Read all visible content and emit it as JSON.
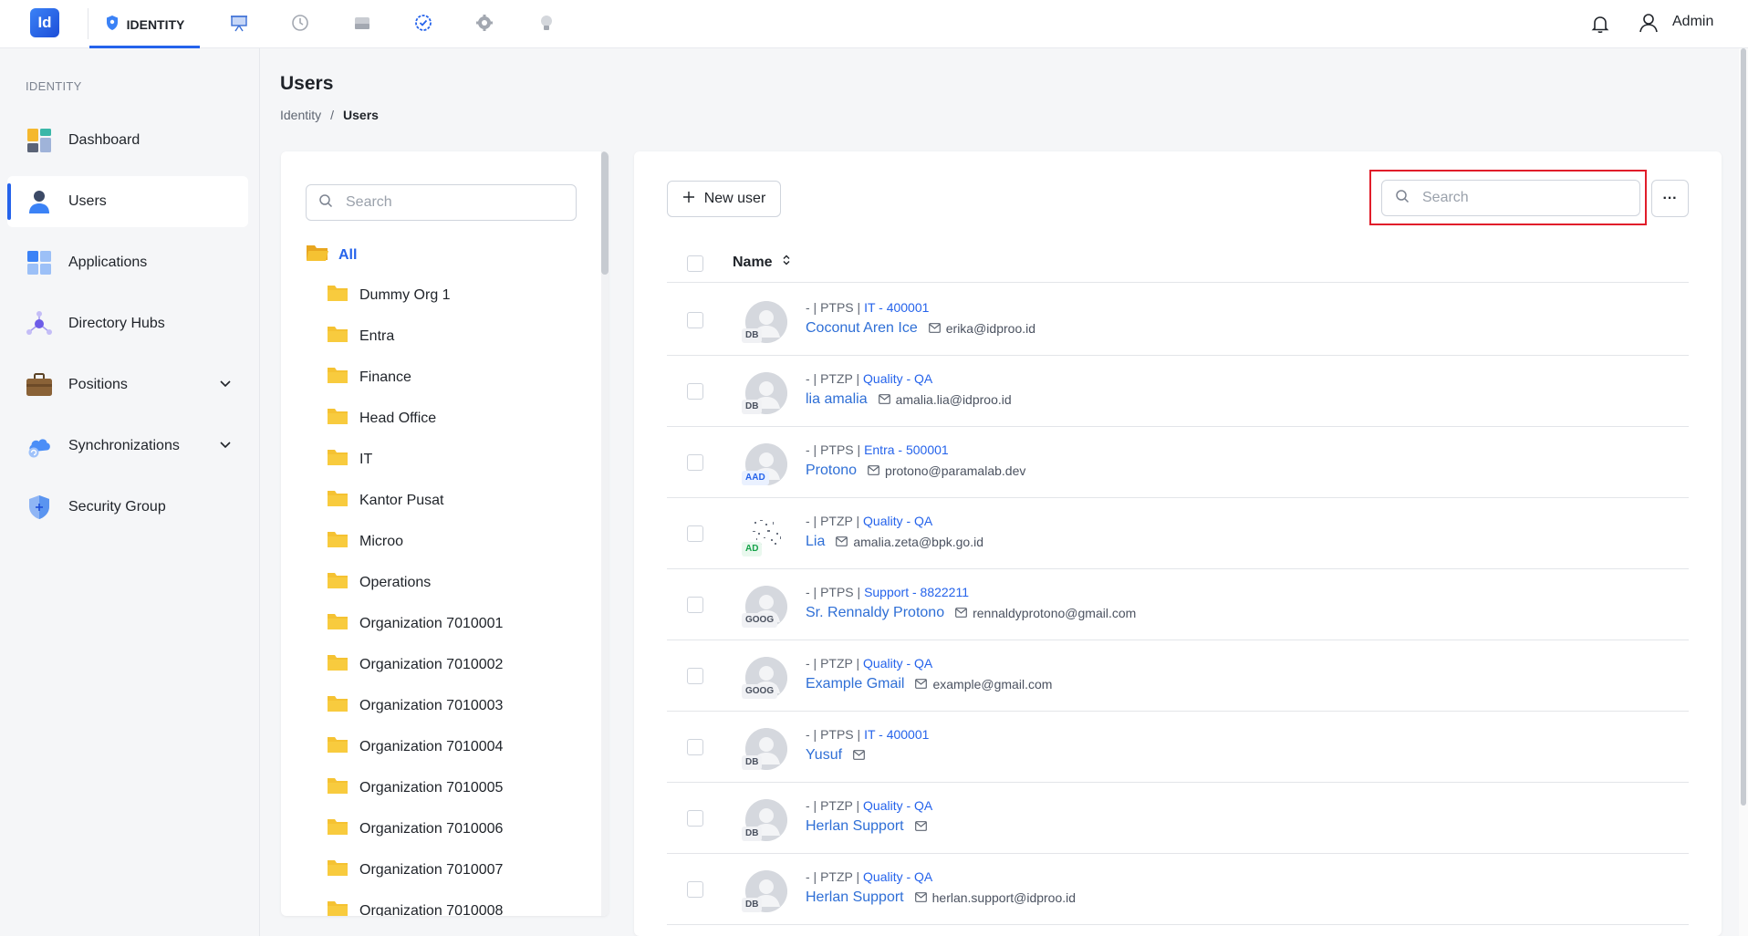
{
  "app": {
    "logo_text": "Id",
    "active_module": "IDENTITY",
    "user_label": "Admin"
  },
  "top_nav_icons": [
    "shield-icon",
    "presentation-icon",
    "history-icon",
    "drive-icon",
    "check-circle-icon",
    "gear-icon",
    "lightbulb-icon"
  ],
  "sidebar": {
    "section": "IDENTITY",
    "items": [
      {
        "label": "Dashboard",
        "icon": "dashboard-icon"
      },
      {
        "label": "Users",
        "icon": "user-icon",
        "active": true
      },
      {
        "label": "Applications",
        "icon": "applications-icon"
      },
      {
        "label": "Directory Hubs",
        "icon": "hub-icon"
      },
      {
        "label": "Positions",
        "icon": "briefcase-icon",
        "expandable": true
      },
      {
        "label": "Synchronizations",
        "icon": "cloud-sync-icon",
        "expandable": true
      },
      {
        "label": "Security Group",
        "icon": "shield-plus-icon"
      }
    ]
  },
  "page": {
    "title": "Users",
    "breadcrumb": [
      "Identity",
      "/",
      "Users"
    ]
  },
  "org_panel": {
    "search_placeholder": "Search",
    "all_label": "All",
    "items": [
      "Dummy Org 1",
      "Entra",
      "Finance",
      "Head Office",
      "IT",
      "Kantor Pusat",
      "Microo",
      "Operations",
      "Organization 7010001",
      "Organization 7010002",
      "Organization 7010003",
      "Organization 7010004",
      "Organization 7010005",
      "Organization 7010006",
      "Organization 7010007",
      "Organization 7010008"
    ]
  },
  "users_panel": {
    "new_user_label": "New user",
    "search_placeholder": "Search",
    "more_label": "···",
    "column_name": "Name",
    "rows": [
      {
        "prefix": "- | PTPS | ",
        "dept": "IT - 400001",
        "name": "Coconut Aren Ice",
        "email": "erika@idproo.id",
        "badge": "DB"
      },
      {
        "prefix": "- | PTZP | ",
        "dept": "Quality - QA",
        "name": "lia amalia",
        "email": "amalia.lia@idproo.id",
        "badge": "DB"
      },
      {
        "prefix": "- | PTPS | ",
        "dept": "Entra - 500001",
        "name": "Protono",
        "email": "protono@paramalab.dev",
        "badge": "AAD"
      },
      {
        "prefix": "- | PTZP | ",
        "dept": "Quality - QA",
        "name": "Lia",
        "email": "amalia.zeta@bpk.go.id",
        "badge": "AD"
      },
      {
        "prefix": "- | PTPS | ",
        "dept": "Support - 8822211",
        "name": "Sr. Rennaldy Protono",
        "email": "rennaldyprotono@gmail.com",
        "badge": "GOOG"
      },
      {
        "prefix": "- | PTZP | ",
        "dept": "Quality - QA",
        "name": "Example Gmail",
        "email": "example@gmail.com",
        "badge": "GOOG"
      },
      {
        "prefix": "- | PTPS | ",
        "dept": "IT - 400001",
        "name": "Yusuf",
        "email": "",
        "badge": "DB"
      },
      {
        "prefix": "- | PTZP | ",
        "dept": "Quality - QA",
        "name": "Herlan Support",
        "email": "",
        "badge": "DB"
      },
      {
        "prefix": "- | PTZP | ",
        "dept": "Quality - QA",
        "name": "Herlan Support",
        "email": "herlan.support@idproo.id",
        "badge": "DB"
      }
    ]
  },
  "colors": {
    "accent": "#2563eb",
    "link": "#2f6fd6",
    "highlight_border": "#e11d2a",
    "folder": "#f5c232"
  }
}
